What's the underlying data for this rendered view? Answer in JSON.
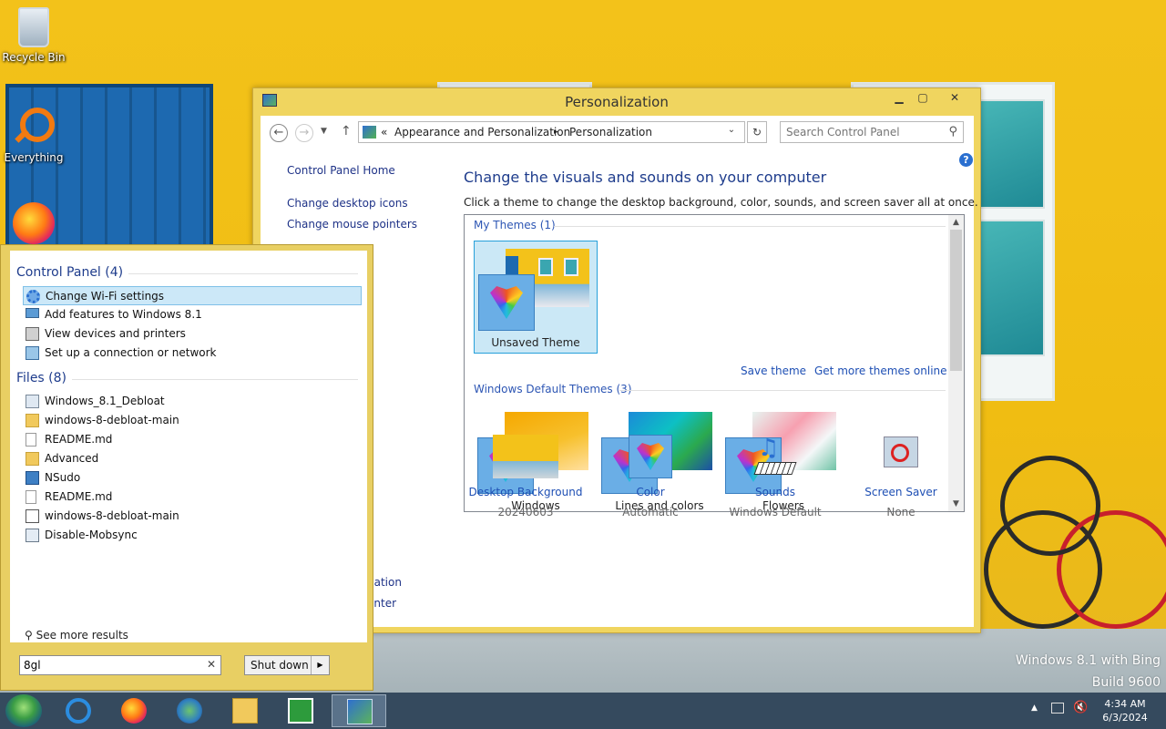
{
  "desktop": {
    "icons": [
      {
        "label": "Recycle Bin",
        "icon": "recycle-bin-icon"
      },
      {
        "label": "Everything",
        "icon": "everything-search-icon"
      },
      {
        "label": "",
        "icon": "firefox-icon"
      }
    ],
    "watermark_line1": "Windows 8.1 with Bing",
    "watermark_line2": "Build 9600"
  },
  "window": {
    "title": "Personalization",
    "address": {
      "prefix": "«",
      "crumbs": [
        "Appearance and Personalization",
        "Personalization"
      ],
      "separator": "▸"
    },
    "search_placeholder": "Search Control Panel",
    "left_nav": [
      "Control Panel Home",
      "Change desktop icons",
      "Change mouse pointers",
      "gation",
      "enter"
    ],
    "heading": "Change the visuals and sounds on your computer",
    "subheading": "Click a theme to change the desktop background, color, sounds, and screen saver all at once.",
    "my_themes_label": "My Themes (1)",
    "my_themes": [
      {
        "name": "Unsaved Theme"
      }
    ],
    "save_theme": "Save theme",
    "get_more": "Get more themes online",
    "default_themes_label": "Windows Default Themes (3)",
    "default_themes": [
      {
        "name": "Windows"
      },
      {
        "name": "Lines and colors"
      },
      {
        "name": "Flowers"
      }
    ],
    "bottom": [
      {
        "name": "Desktop Background",
        "value": "20240603"
      },
      {
        "name": "Color",
        "value": "Automatic"
      },
      {
        "name": "Sounds",
        "value": "Windows Default"
      },
      {
        "name": "Screen Saver",
        "value": "None"
      }
    ]
  },
  "start": {
    "cp_label": "Control Panel (4)",
    "cp_items": [
      {
        "label": "Change Wi-Fi settings",
        "icon": "gear-icon"
      },
      {
        "label": "Add features to Windows 8.1",
        "icon": "monitor-icon"
      },
      {
        "label": "View devices and printers",
        "icon": "printer-icon"
      },
      {
        "label": "Set up a connection or network",
        "icon": "network-icon"
      }
    ],
    "files_label": "Files (8)",
    "files": [
      {
        "label": "Windows_8.1_Debloat",
        "icon": "image-file-icon"
      },
      {
        "label": "windows-8-debloat-main",
        "icon": "folder-icon"
      },
      {
        "label": "README.md",
        "icon": "document-icon"
      },
      {
        "label": "Advanced",
        "icon": "folder-icon"
      },
      {
        "label": "NSudo",
        "icon": "app-icon"
      },
      {
        "label": "README.md",
        "icon": "document-icon"
      },
      {
        "label": "windows-8-debloat-main",
        "icon": "shortcut-icon"
      },
      {
        "label": "Disable-Mobsync",
        "icon": "script-icon"
      }
    ],
    "see_more": "See more results",
    "search_value": "8gl",
    "shutdown": "Shut down"
  },
  "taskbar": {
    "time": "4:34 AM",
    "date": "6/3/2024",
    "apps": [
      "internet-explorer-icon",
      "firefox-icon",
      "network-globe-icon",
      "file-explorer-icon",
      "store-icon",
      "control-panel-icon"
    ]
  },
  "colors": {
    "link": "#1e4fb4",
    "heading": "#1e3c8c",
    "selection": "#cbe8f6",
    "window_frame": "#f0d55f"
  }
}
